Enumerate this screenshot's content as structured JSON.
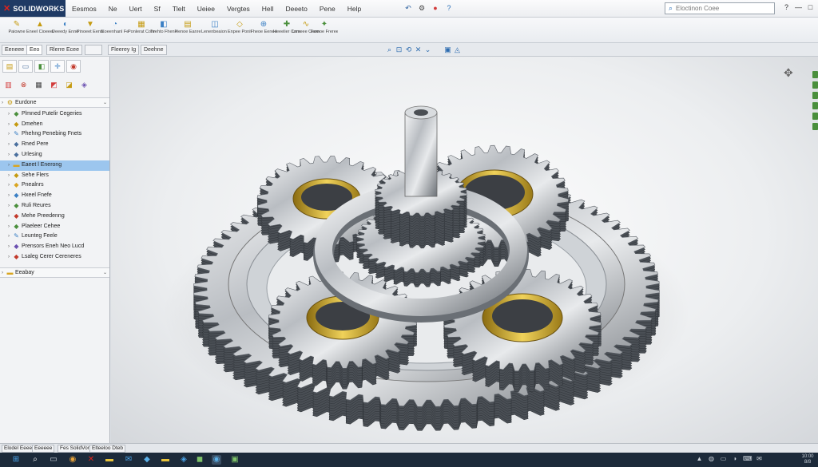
{
  "app": {
    "logo_mark": "✕",
    "name": "SOLIDWORKS"
  },
  "menu": [
    "Eesmos",
    "Ne",
    "Uert",
    "Sf",
    "Tlelt",
    "Ueiee",
    "Vergtes",
    "Hell",
    "Deeeto",
    "Pene",
    "Help"
  ],
  "quick_icons": [
    {
      "name": "undo-icon",
      "glyph": "↶",
      "color": "#2a5f9e"
    },
    {
      "name": "settings-icon",
      "glyph": "⚙",
      "color": "#444"
    },
    {
      "name": "record-icon",
      "glyph": "●",
      "color": "#d23a3a"
    },
    {
      "name": "help-icon",
      "glyph": "?",
      "color": "#2a6fb8"
    }
  ],
  "search": {
    "placeholder": "Eloctinon Coee",
    "icon": "search-icon"
  },
  "window_controls": [
    "?",
    "—",
    "□",
    "✕"
  ],
  "ribbon": [
    {
      "label": "Paiowne",
      "icon": "sketch-icon",
      "glyph": "✎",
      "color": "#c59a10"
    },
    {
      "label": "Eneel Cioeeeel",
      "icon": "extrude-icon",
      "glyph": "▲",
      "color": "#c59a10"
    },
    {
      "label": "Deeedy Ennee",
      "icon": "revolve-icon",
      "glyph": "◐",
      "color": "#3a7fc4"
    },
    {
      "label": "Pinoeet Eente",
      "icon": "cut-icon",
      "glyph": "▼",
      "color": "#c59a10"
    },
    {
      "label": "Eoeenhanl Feteetie",
      "icon": "fillet-icon",
      "glyph": "◔",
      "color": "#3a7fc4"
    },
    {
      "label": "Ponlerat Conneet",
      "icon": "pattern-icon",
      "glyph": "▦",
      "color": "#c59a10"
    },
    {
      "label": "Teehto Fheninte",
      "icon": "mirror-icon",
      "glyph": "◧",
      "color": "#3a7fc4"
    },
    {
      "label": "Fienoe Eanre",
      "icon": "rib-icon",
      "glyph": "▤",
      "color": "#c59a10"
    },
    {
      "label": "Lenenbeaion Fnene",
      "icon": "shell-icon",
      "glyph": "◫",
      "color": "#3a7fc4"
    },
    {
      "label": "Enpee Ponit",
      "icon": "plane-icon",
      "glyph": "◇",
      "color": "#c59a10"
    },
    {
      "label": "Fheoe Eenee",
      "icon": "axis-icon",
      "glyph": "⊕",
      "color": "#3a7fc4"
    },
    {
      "label": "Heeelier Cnneveet",
      "icon": "coordinate-icon",
      "glyph": "✚",
      "color": "#4a8f3c"
    },
    {
      "label": "Lrmeee Coeeel",
      "icon": "curves-icon",
      "glyph": "∿",
      "color": "#c59a10"
    },
    {
      "label": "Femoe Frereeeee",
      "icon": "instant3d-icon",
      "glyph": "✦",
      "color": "#4a8f3c"
    }
  ],
  "command_tabs": [
    "Eeneee",
    "Eeo",
    "Rlerre Ecee",
    "",
    "Fleerey Ig",
    "Deehne"
  ],
  "headsup": [
    {
      "name": "zoom-fit-icon",
      "glyph": "⌕"
    },
    {
      "name": "zoom-area-icon",
      "glyph": "⊡"
    },
    {
      "name": "rotate-icon",
      "glyph": "⟲"
    },
    {
      "name": "section-view-icon",
      "glyph": "✕"
    },
    {
      "name": "view-orient-icon",
      "glyph": "⌄"
    },
    {
      "name": "display-style-icon",
      "glyph": "▣"
    },
    {
      "name": "hide-show-icon",
      "glyph": "◬"
    }
  ],
  "panel_tabs": [
    {
      "name": "feature-manager-icon",
      "glyph": "▤",
      "color": "#c59a10"
    },
    {
      "name": "property-manager-icon",
      "glyph": "▭",
      "color": "#4a6f9e"
    },
    {
      "name": "config-manager-icon",
      "glyph": "◧",
      "color": "#4a8f3c"
    },
    {
      "name": "dimxpert-icon",
      "glyph": "✛",
      "color": "#3a7fc4"
    },
    {
      "name": "display-manager-icon",
      "glyph": "◉",
      "color": "#c2392b"
    }
  ],
  "filter_icons": [
    {
      "name": "filter-icon",
      "glyph": "▥",
      "color": "#d23a3a"
    },
    {
      "name": "rebuild-icon",
      "glyph": "⊗",
      "color": "#c2392b"
    },
    {
      "name": "display-pane-icon",
      "glyph": "▦",
      "color": "#444"
    },
    {
      "name": "part-color-icon",
      "glyph": "◩",
      "color": "#d23a3a"
    },
    {
      "name": "appearance-icon",
      "glyph": "◪",
      "color": "#c59a10"
    },
    {
      "name": "scene-icon",
      "glyph": "◈",
      "color": "#6a4fb0"
    }
  ],
  "tree": [
    {
      "label": "Eurdone",
      "level": 0,
      "icon": "assembly-icon",
      "glyph": "⚙",
      "color": "#c59a10",
      "type": "root"
    },
    {
      "label": "Plmned Putelir Cegeries",
      "level": 1,
      "icon": "part-icon",
      "glyph": "◆",
      "color": "#4a8f3c",
      "type": "node"
    },
    {
      "label": "Dmehen",
      "level": 1,
      "icon": "part-icon",
      "glyph": "◆",
      "color": "#c59a10",
      "type": "node"
    },
    {
      "label": "Phehng Penebing Fnets",
      "level": 1,
      "icon": "sketch-icon",
      "glyph": "✎",
      "color": "#3a7fc4",
      "type": "node"
    },
    {
      "label": "Rned Pere",
      "level": 1,
      "icon": "part-icon",
      "glyph": "◆",
      "color": "#4a6f9e",
      "type": "node"
    },
    {
      "label": "Urlesing",
      "level": 1,
      "icon": "part-icon",
      "glyph": "◆",
      "color": "#4a6f9e",
      "type": "node"
    },
    {
      "label": "Eaeet l Enerong",
      "level": 1,
      "icon": "folder-icon",
      "glyph": "▬",
      "color": "#d9a520",
      "type": "selected"
    },
    {
      "label": "Sehe Flers",
      "level": 1,
      "icon": "part-icon",
      "glyph": "◆",
      "color": "#c59a10",
      "type": "node"
    },
    {
      "label": "Pnealnrs",
      "level": 1,
      "icon": "part-icon",
      "glyph": "◆",
      "color": "#d9a520",
      "type": "node"
    },
    {
      "label": "Hxeel Fnefe",
      "level": 1,
      "icon": "part-icon",
      "glyph": "◆",
      "color": "#3a7fc4",
      "type": "node"
    },
    {
      "label": "Ruli Reures",
      "level": 1,
      "icon": "part-icon",
      "glyph": "◆",
      "color": "#4a8f3c",
      "type": "node"
    },
    {
      "label": "Mehe Preedenng",
      "level": 1,
      "icon": "part-icon",
      "glyph": "◆",
      "color": "#c2392b",
      "type": "node"
    },
    {
      "label": "Plaeleer Cehee",
      "level": 1,
      "icon": "part-icon",
      "glyph": "◆",
      "color": "#4a8f3c",
      "type": "node"
    },
    {
      "label": "Leunteg Feele",
      "level": 1,
      "icon": "sketch-icon",
      "glyph": "✎",
      "color": "#3a7fc4",
      "type": "node"
    },
    {
      "label": "Prensors Eneh Neo Lucd",
      "level": 1,
      "icon": "part-icon",
      "glyph": "◆",
      "color": "#6a4fb0",
      "type": "node"
    },
    {
      "label": "Lsaleg Cerer Cereneres",
      "level": 1,
      "icon": "part-icon",
      "glyph": "◆",
      "color": "#c2392b",
      "type": "node"
    },
    {
      "label": "Eeabay",
      "level": 0,
      "icon": "folder-icon",
      "glyph": "▬",
      "color": "#d9a520",
      "type": "footer"
    }
  ],
  "bottom_tabs": [
    "Elodel Eeee",
    "Eeeeee",
    "Fes SolidVorted",
    "Elteeloo Dteb"
  ],
  "taskbar": [
    {
      "name": "start-icon",
      "glyph": "⊞",
      "color": "#4aa3e8"
    },
    {
      "name": "search-taskbar-icon",
      "glyph": "⌕",
      "color": "#ffffff"
    },
    {
      "name": "task-view-icon",
      "glyph": "▭",
      "color": "#cfd6de"
    },
    {
      "name": "browser-icon",
      "glyph": "◉",
      "color": "#e8a33a"
    },
    {
      "name": "solidworks-taskbar-icon",
      "glyph": "✕",
      "color": "#e2231a"
    },
    {
      "name": "files-icon",
      "glyph": "▬",
      "color": "#e8c33a"
    },
    {
      "name": "mail-icon",
      "glyph": "✉",
      "color": "#4aa3e8"
    },
    {
      "name": "store-icon",
      "glyph": "◆",
      "color": "#5bb0e8"
    },
    {
      "name": "folder-taskbar-icon",
      "glyph": "▬",
      "color": "#e8c33a"
    },
    {
      "name": "photos-icon",
      "glyph": "◈",
      "color": "#4aa3e8"
    },
    {
      "name": "app-icon",
      "glyph": "◼",
      "color": "#7fc36a"
    },
    {
      "name": "active-app-icon",
      "glyph": "◉",
      "color": "#5bb0e8"
    },
    {
      "name": "terminal-icon",
      "glyph": "▣",
      "color": "#7fc36a"
    }
  ],
  "tray": [
    "▲",
    "◍",
    "▭",
    "◗",
    "⌨",
    "✉"
  ],
  "clock": {
    "time": "10:00",
    "date": "8/8"
  },
  "colors": {
    "title_bg": "#1f3a64",
    "selection": "#9cc6ee",
    "taskbar": "#1c2a3a",
    "brass": "#d7b43b"
  }
}
